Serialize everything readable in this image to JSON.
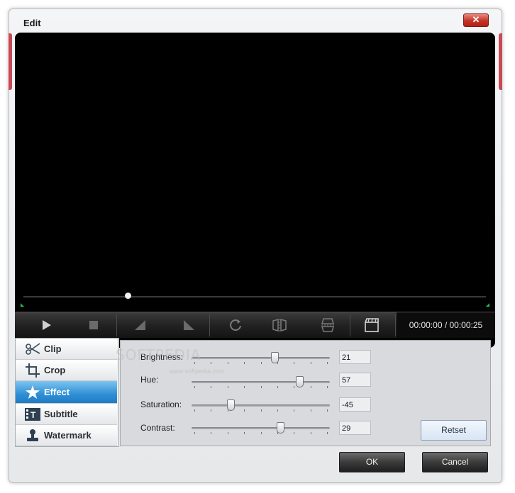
{
  "window": {
    "title": "Edit",
    "close_label": "✕"
  },
  "player": {
    "progress_fraction": 0.225,
    "time_display": "00:00:00 / 00:00:25",
    "buttons": [
      "play-icon",
      "stop-icon",
      "mark-in-icon",
      "mark-out-icon",
      "rotate-icon",
      "flip-horizontal-icon",
      "flip-vertical-icon",
      "snapshot-icon"
    ]
  },
  "sidebar": {
    "tabs": [
      {
        "label": "Clip",
        "icon": "scissors-icon"
      },
      {
        "label": "Crop",
        "icon": "crop-icon"
      },
      {
        "label": "Effect",
        "icon": "star-icon",
        "active": true
      },
      {
        "label": "Subtitle",
        "icon": "subtitle-icon"
      },
      {
        "label": "Watermark",
        "icon": "stamp-icon"
      }
    ]
  },
  "effect": {
    "brightness": {
      "label": "Brightness:",
      "value": "21",
      "fraction": 0.6
    },
    "hue": {
      "label": "Hue:",
      "value": "57",
      "fraction": 0.78
    },
    "saturation": {
      "label": "Saturation:",
      "value": "-45",
      "fraction": 0.28
    },
    "contrast": {
      "label": "Contrast:",
      "value": "29",
      "fraction": 0.64
    },
    "reset_label": "Retset"
  },
  "footer": {
    "ok_label": "OK",
    "cancel_label": "Cancel"
  },
  "watermark": {
    "text": "SOFTPEDIA",
    "sub": "www.softpedia.com"
  },
  "colors": {
    "accent": "#2f8fd6",
    "close": "#c43325",
    "marker": "#22c04a"
  }
}
